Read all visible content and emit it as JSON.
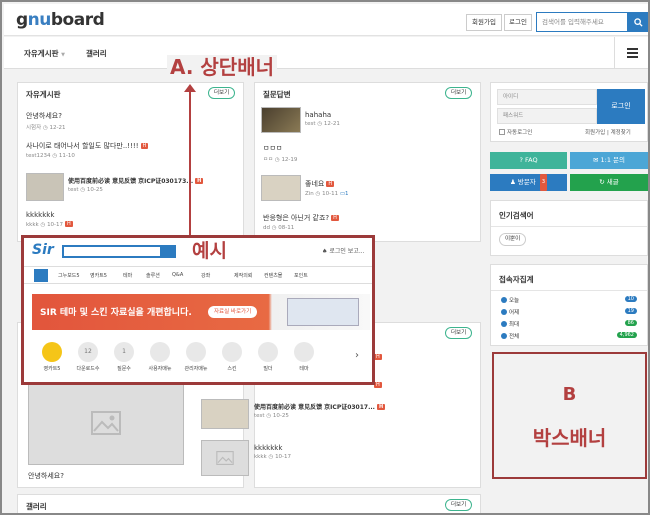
{
  "header": {
    "logo": "gnuboard",
    "logo_accent": "nu",
    "join": "회원가입",
    "login": "로그인",
    "search_placeholder": "검색어를 입력해주세요"
  },
  "nav": {
    "items": [
      "자유게시판",
      "갤러리"
    ]
  },
  "free_board": {
    "title": "자유게시판",
    "more": "더보기",
    "posts": [
      {
        "title": "안녕하세요?",
        "author": "시험자",
        "date": "12-21",
        "badge": ""
      },
      {
        "title": "사나이로 태어나서 할일도 많다만..!!!!",
        "author": "test1234",
        "date": "11-10",
        "badge": "H"
      },
      {
        "title": "使用百度前必读 意见反馈 京ICP证030173...",
        "author": "test",
        "date": "10-25",
        "badge": "H"
      },
      {
        "title": "kkkkkkk",
        "author": "kkkk",
        "date": "10-17",
        "badge": "H"
      }
    ]
  },
  "qna_board": {
    "title": "질문답변",
    "more": "더보기",
    "posts": [
      {
        "title": "hahaha",
        "author": "test",
        "date": "12-21",
        "badge": ""
      },
      {
        "title": "ㅁㅁㅁ",
        "author": "ㅁㅁ",
        "date": "12-19",
        "badge": ""
      },
      {
        "title": "좋네요",
        "author": "Zin",
        "date": "10-11",
        "comments": "1",
        "badge": "H"
      },
      {
        "title": "반응형은 아닌거 같죠?",
        "author": "dd",
        "date": "08-11",
        "badge": "H"
      }
    ]
  },
  "lower": {
    "more1": "더보기",
    "more2": "더보기",
    "gallery_caption": "안녕하세요?",
    "posts": [
      {
        "title": "使用百度前必读 意见反馈 京ICP证03017...",
        "author": "test",
        "date": "10-25",
        "badge": "H"
      },
      {
        "title": "kkkkkkk",
        "author": "kkkk",
        "date": "10-17",
        "badge": ""
      }
    ]
  },
  "gallery_section": {
    "title": "갤러리",
    "more": "더보기"
  },
  "login_box": {
    "id_placeholder": "아이디",
    "pw_placeholder": "패스워드",
    "login": "로그인",
    "auto": "자동로그인",
    "join": "회원가입",
    "find": "계정찾기",
    "join_sep": "|"
  },
  "quick": {
    "faq": "FAQ",
    "inquiry": "1:1 문의",
    "visitor": "방문자",
    "visitor_count": "3",
    "new": "새글"
  },
  "popular": {
    "title": "인기검색어",
    "tag": "이뿐이"
  },
  "stats": {
    "title": "접속자집계",
    "rows": [
      {
        "label": "오늘",
        "value": "10"
      },
      {
        "label": "어제",
        "value": "19"
      },
      {
        "label": "최대",
        "value": "86"
      },
      {
        "label": "전체",
        "value": "4,962"
      }
    ]
  },
  "annotations": {
    "a": "A. 상단배너",
    "example": "예시",
    "b1": "B",
    "b2": "박스배너"
  },
  "example": {
    "login_link": "로그인",
    "more_link": "보고...",
    "menu": [
      "그누보드5",
      "영카트5",
      "테마",
      "솔루션",
      "Q&A",
      "강좌",
      "제작의뢰",
      "컨텐츠몰",
      "포인트"
    ],
    "banner": "SIR 테마 및 스킨 자료실을 개편합니다.",
    "banner_btn": "자료실 바로가기",
    "icons": [
      {
        "num": "",
        "label": "영카트5"
      },
      {
        "num": "12",
        "label": "다운로드수"
      },
      {
        "num": "1",
        "label": "질문수"
      },
      {
        "num": "",
        "label": "사용자매뉴"
      },
      {
        "num": "",
        "label": "관리자매뉴"
      },
      {
        "num": "",
        "label": "스킨"
      },
      {
        "num": "",
        "label": "빌더"
      },
      {
        "num": "",
        "label": "테마"
      }
    ]
  },
  "colors": {
    "primary": "#2c7bc0",
    "teal": "#3fb49a",
    "sky": "#4ca6d6",
    "green": "#23a24d",
    "annot": "#b34040",
    "badge": "#e2583e"
  }
}
